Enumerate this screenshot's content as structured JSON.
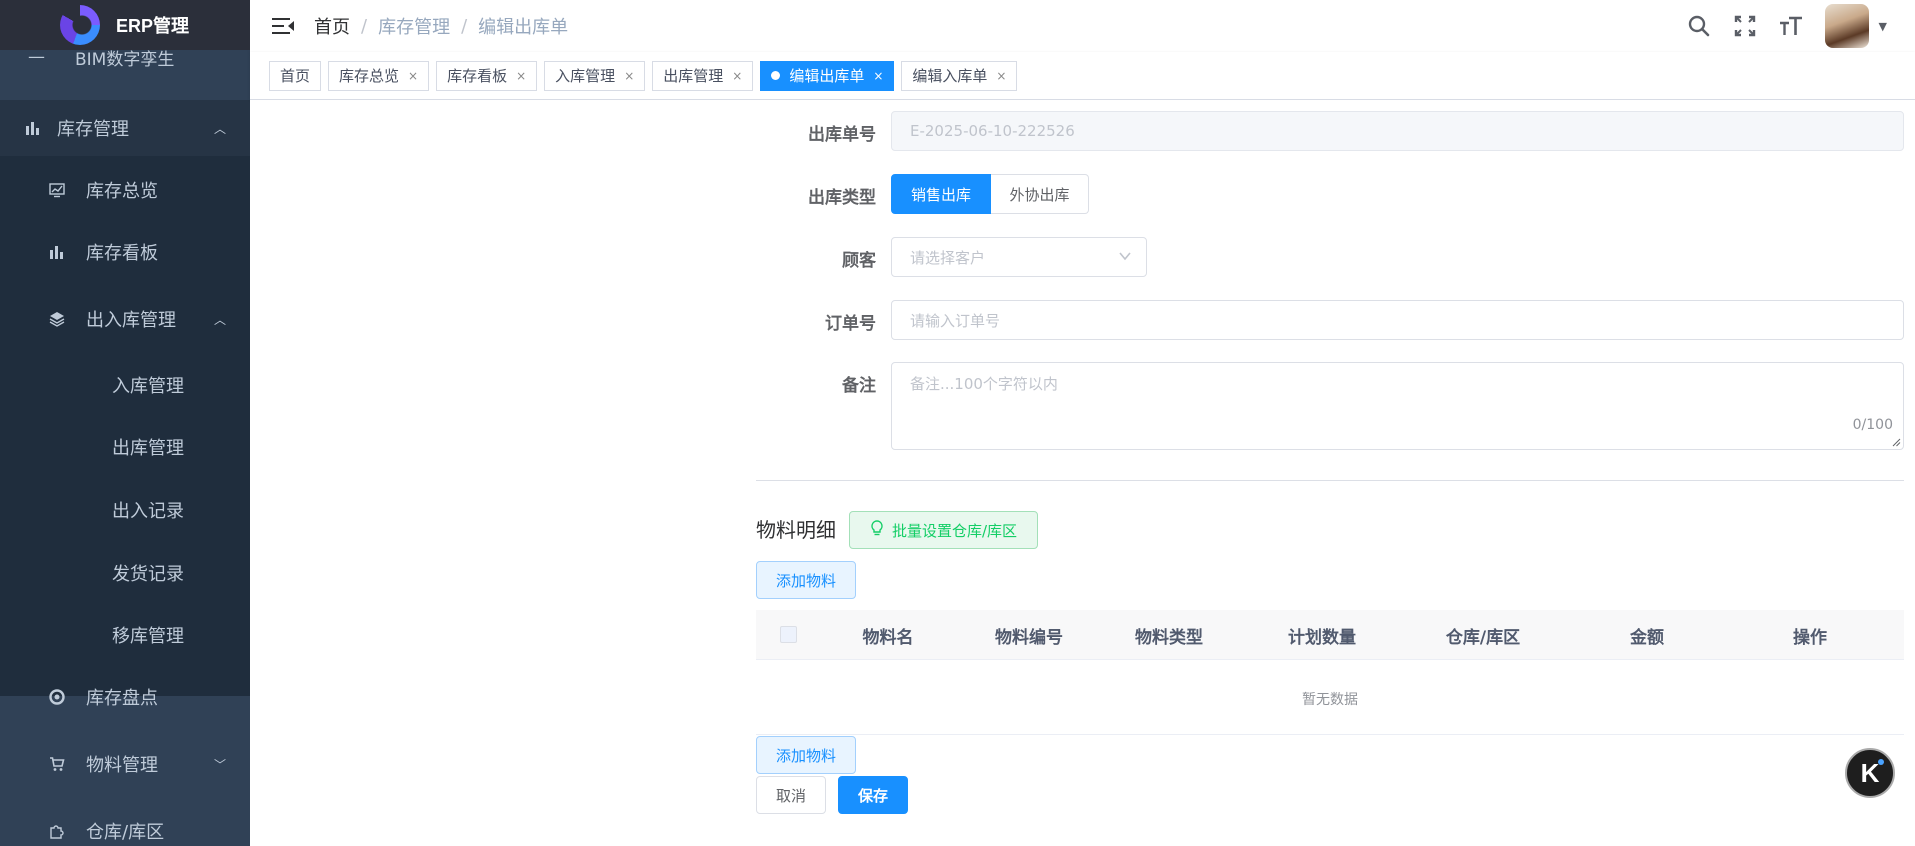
{
  "app": {
    "title": "ERP管理"
  },
  "sidebar": {
    "clipped_item": "BIM数字孪生",
    "items": [
      {
        "label": "库存管理",
        "icon": "bar-chart-icon",
        "expanded": true
      },
      {
        "label": "库存总览",
        "icon": "monitor-chart-icon"
      },
      {
        "label": "库存看板",
        "icon": "bar-chart-icon"
      },
      {
        "label": "出入库管理",
        "icon": "layers-icon",
        "expanded": true
      },
      {
        "label": "入库管理"
      },
      {
        "label": "出库管理"
      },
      {
        "label": "出入记录"
      },
      {
        "label": "发货记录"
      },
      {
        "label": "移库管理"
      },
      {
        "label": "库存盘点",
        "icon": "aperture-icon"
      },
      {
        "label": "物料管理",
        "icon": "cart-icon",
        "expanded": false
      },
      {
        "label": "仓库/库区",
        "icon": "puzzle-icon"
      }
    ]
  },
  "header": {
    "breadcrumb": [
      "首页",
      "库存管理",
      "编辑出库单"
    ],
    "separator": "/"
  },
  "tags": [
    {
      "label": "首页",
      "closable": false,
      "active": false
    },
    {
      "label": "库存总览",
      "closable": true,
      "active": false
    },
    {
      "label": "库存看板",
      "closable": true,
      "active": false
    },
    {
      "label": "入库管理",
      "closable": true,
      "active": false
    },
    {
      "label": "出库管理",
      "closable": true,
      "active": false
    },
    {
      "label": "编辑出库单",
      "closable": true,
      "active": true
    },
    {
      "label": "编辑入库单",
      "closable": true,
      "active": false
    }
  ],
  "tag_close": "×",
  "form": {
    "order_no": {
      "label": "出库单号",
      "value": "E-2025-06-10-222526"
    },
    "type": {
      "label": "出库类型",
      "options": [
        "销售出库",
        "外协出库"
      ],
      "selected": "销售出库"
    },
    "customer": {
      "label": "顾客",
      "placeholder": "请选择客户"
    },
    "sales_order": {
      "label": "订单号",
      "placeholder": "请输入订单号"
    },
    "remark": {
      "label": "备注",
      "placeholder": "备注...100个字符以内",
      "count": "0/100"
    }
  },
  "materials": {
    "title": "物料明细",
    "batch_button": "批量设置仓库/库区",
    "add_button": "添加物料",
    "columns": [
      "物料名",
      "物料编号",
      "物料类型",
      "计划数量",
      "仓库/库区",
      "金额",
      "操作"
    ],
    "empty_text": "暂无数据"
  },
  "footer": {
    "add_button": "添加物料",
    "cancel_button": "取消",
    "save_button": "保存"
  },
  "float_button": "K"
}
